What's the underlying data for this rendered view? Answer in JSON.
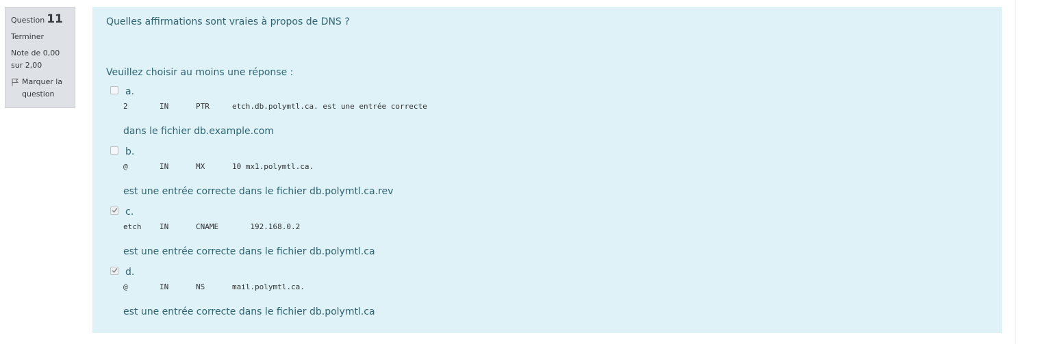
{
  "info": {
    "question_label": "Question",
    "question_number": "11",
    "state": "Terminer",
    "grade_line1": "Note de 0,00",
    "grade_line2": "sur 2,00",
    "flag_label": "Marquer la question"
  },
  "question": {
    "text": "Quelles affirmations sont vraies à propos de DNS ?",
    "prompt": "Veuillez choisir au moins une réponse :",
    "answers": [
      {
        "letter": "a.",
        "checked": false,
        "code": "2       IN      PTR     etch.db.polymtl.ca. est une entrée correcte",
        "description": "dans le fichier db.example.com"
      },
      {
        "letter": "b.",
        "checked": false,
        "code": "@       IN      MX      10 mx1.polymtl.ca.",
        "description": "est une entrée correcte dans le fichier db.polymtl.ca.rev"
      },
      {
        "letter": "c.",
        "checked": true,
        "code": "etch    IN      CNAME       192.168.0.2",
        "description": "est une entrée correcte dans le fichier db.polymtl.ca"
      },
      {
        "letter": "d.",
        "checked": true,
        "code": "@       IN      NS      mail.polymtl.ca.",
        "description": "est une entrée correcte dans le fichier db.polymtl.ca"
      }
    ]
  },
  "colors": {
    "content_bg": "#def2f8",
    "content_text": "#2f6473",
    "info_bg": "#dee2e6"
  },
  "icons": {
    "flag": "flag-outline-icon",
    "check": "checkmark-icon"
  }
}
